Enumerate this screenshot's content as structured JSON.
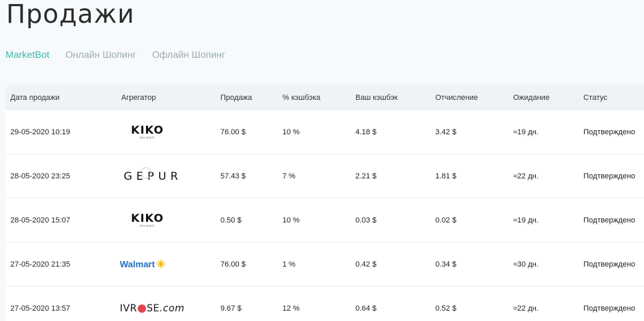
{
  "page": {
    "title": "Продажи"
  },
  "tabs": [
    {
      "label": "MarketBot",
      "active": true
    },
    {
      "label": "Онлайн Шопинг",
      "active": false
    },
    {
      "label": "Офлайн Шопинг",
      "active": false
    }
  ],
  "table": {
    "headers": [
      "Дата продажи",
      "Агрегатор",
      "Продажа",
      "% кэшбэка",
      "Ваш кэшбэк",
      "Отчисление",
      "Ожидание",
      "Статус"
    ],
    "rows": [
      {
        "date": "29-05-2020 10:19",
        "aggregator": "KIKO",
        "aggregator_sub": "MILANO",
        "sale": "76.00 $",
        "percent": "10 %",
        "cashback": "4.18 $",
        "deduction": "3.42 $",
        "waiting": "≈19 дн.",
        "status": "Подтверждено"
      },
      {
        "date": "28-05-2020 23:25",
        "aggregator": "GEPUR",
        "aggregator_sub": "",
        "sale": "57.43 $",
        "percent": "7 %",
        "cashback": "2.21 $",
        "deduction": "1.81 $",
        "waiting": "≈22 дн.",
        "status": "Подтверждено"
      },
      {
        "date": "28-05-2020 15:07",
        "aggregator": "KIKO",
        "aggregator_sub": "MILANO",
        "sale": "0.50 $",
        "percent": "10 %",
        "cashback": "0.03 $",
        "deduction": "0.02 $",
        "waiting": "≈19 дн.",
        "status": "Подтверждено"
      },
      {
        "date": "27-05-2020 21:35",
        "aggregator": "Walmart",
        "aggregator_sub": "",
        "sale": "76.00 $",
        "percent": "1 %",
        "cashback": "0.42 $",
        "deduction": "0.34 $",
        "waiting": "≈30 дн.",
        "status": "Подтверждено"
      },
      {
        "date": "27-05-2020 13:57",
        "aggregator": "IVROSE.com",
        "aggregator_sub": "",
        "sale": "9.67 $",
        "percent": "12 %",
        "cashback": "0.64 $",
        "deduction": "0.52 $",
        "waiting": "≈22 дн.",
        "status": "Подтверждено"
      }
    ]
  },
  "logos": {
    "ivrose_left": "IVR",
    "ivrose_right": "SE",
    "ivrose_tail": ".com",
    "walmart_spark": "✳"
  },
  "colors": {
    "accent": "#3bb8a9",
    "tab_inactive": "#9aacb4",
    "header_bg": "#edf3f7",
    "walmart_blue": "#1f6fc2",
    "walmart_yellow": "#f5b800",
    "ivrose_red": "#e0464a"
  }
}
